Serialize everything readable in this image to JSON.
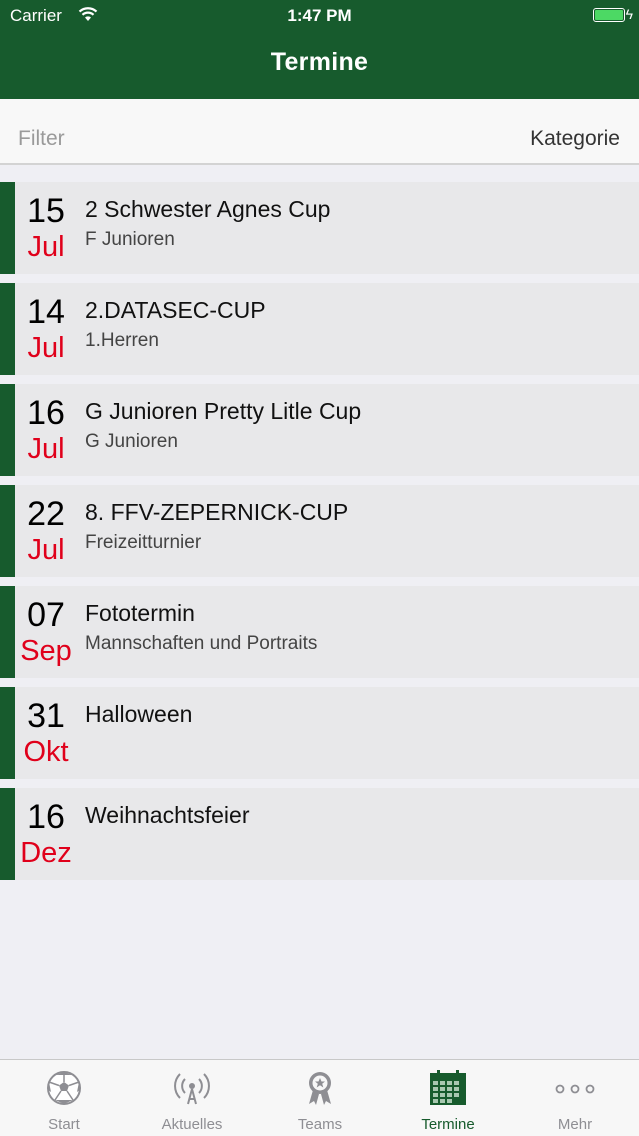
{
  "status_bar": {
    "carrier": "Carrier",
    "time": "1:47 PM"
  },
  "header": {
    "title": "Termine"
  },
  "filter_bar": {
    "placeholder": "Filter",
    "category_label": "Kategorie"
  },
  "events": [
    {
      "day": "15",
      "month": "Jul",
      "title": "2 Schwester Agnes Cup",
      "subtitle": "F Junioren"
    },
    {
      "day": "14",
      "month": "Jul",
      "title": "2.DATASEC-CUP",
      "subtitle": "1.Herren"
    },
    {
      "day": "16",
      "month": "Jul",
      "title": "G Junioren Pretty Litle Cup",
      "subtitle": "G Junioren"
    },
    {
      "day": "22",
      "month": "Jul",
      "title": "8. FFV-ZEPERNICK-CUP",
      "subtitle": "Freizeitturnier"
    },
    {
      "day": "07",
      "month": "Sep",
      "title": "Fototermin",
      "subtitle": "Mannschaften und Portraits"
    },
    {
      "day": "31",
      "month": "Okt",
      "title": "Halloween",
      "subtitle": ""
    },
    {
      "day": "16",
      "month": "Dez",
      "title": "Weihnachtsfeier",
      "subtitle": ""
    }
  ],
  "tabs": [
    {
      "label": "Start",
      "icon": "soccer-ball-icon"
    },
    {
      "label": "Aktuelles",
      "icon": "broadcast-icon"
    },
    {
      "label": "Teams",
      "icon": "award-badge-icon"
    },
    {
      "label": "Termine",
      "icon": "calendar-icon",
      "active": true
    },
    {
      "label": "Mehr",
      "icon": "more-dots-icon"
    }
  ],
  "colors": {
    "brand_green": "#175b2d",
    "month_red": "#e0001b",
    "tab_inactive": "#8e8e93"
  }
}
